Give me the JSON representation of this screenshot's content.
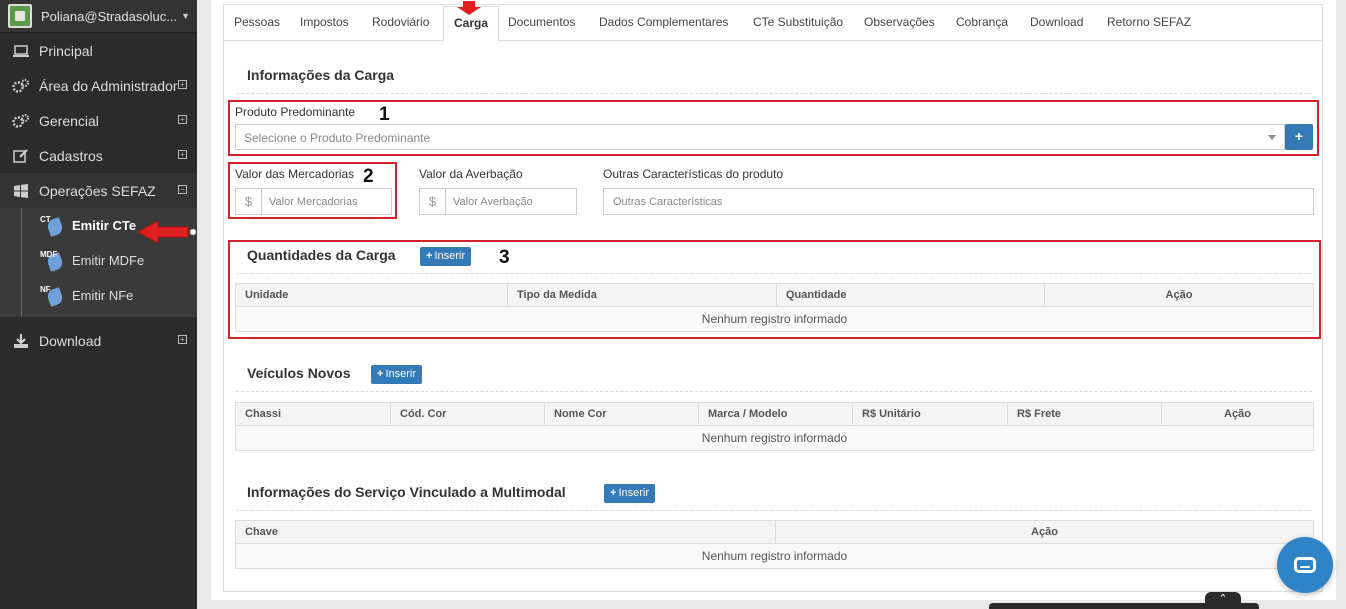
{
  "sidebar": {
    "user_name": "Poliana@Stradasoluc...",
    "items": [
      {
        "label": "Principal",
        "icon": "laptop-icon"
      },
      {
        "label": "Área do Administrador",
        "icon": "gears-icon"
      },
      {
        "label": "Gerencial",
        "icon": "gears-icon"
      },
      {
        "label": "Cadastros",
        "icon": "edit-icon"
      },
      {
        "label": "Operações SEFAZ",
        "icon": "windows-icon"
      }
    ],
    "sub_items": [
      {
        "label": "Emitir CTe",
        "tag": "CT"
      },
      {
        "label": "Emitir MDFe",
        "tag": "MDF"
      },
      {
        "label": "Emitir NFe",
        "tag": "NF"
      }
    ],
    "download_label": "Download"
  },
  "tabs": [
    "Pessoas",
    "Impostos",
    "Rodoviário",
    "Carga",
    "Documentos",
    "Dados Complementares",
    "CTe Substituição",
    "Observações",
    "Cobrança",
    "Download",
    "Retorno SEFAZ"
  ],
  "active_tab": "Carga",
  "info_carga": {
    "title": "Informações da Carga",
    "produto_label": "Produto Predominante",
    "produto_placeholder": "Selecione o Produto Predominante",
    "valor_merc_label": "Valor das Mercadorias",
    "valor_merc_placeholder": "Valor Mercadorias",
    "valor_averb_label": "Valor da Averbação",
    "valor_averb_placeholder": "Valor Averbação",
    "outras_label": "Outras Características do produto",
    "outras_placeholder": "Outras Características",
    "currency_symbol": "$",
    "plus_symbol": "+"
  },
  "quantidades": {
    "title": "Quantidades da Carga",
    "insert_label": "Inserir",
    "columns": [
      "Unidade",
      "Tipo da Medida",
      "Quantidade",
      "Ação"
    ],
    "empty": "Nenhum registro informado"
  },
  "veiculos": {
    "title": "Veículos Novos",
    "insert_label": "Inserir",
    "columns": [
      "Chassi",
      "Cód. Cor",
      "Nome Cor",
      "Marca / Modelo",
      "R$ Unitário",
      "R$ Frete",
      "Ação"
    ],
    "empty": "Nenhum registro informado"
  },
  "multimodal": {
    "title": "Informações do Serviço Vinculado a Multimodal",
    "insert_label": "Inserir",
    "columns": [
      "Chave",
      "Ação"
    ],
    "empty": "Nenhum registro informado"
  },
  "annotations": [
    "1",
    "2",
    "3"
  ],
  "colors": {
    "annotation_red": "#d3232a",
    "primary": "#337ab7",
    "sidebar": "#2b2b2b"
  }
}
